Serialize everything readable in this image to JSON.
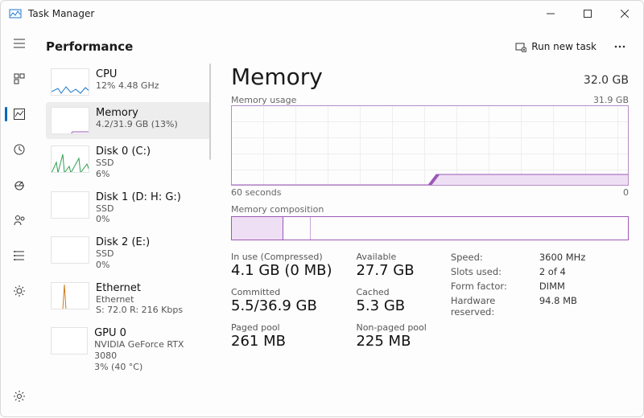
{
  "window": {
    "title": "Task Manager"
  },
  "header": {
    "page": "Performance",
    "run_new_task": "Run new task"
  },
  "sidebar": [
    {
      "title": "CPU",
      "sub1": "12% 4.48 GHz",
      "sub2": ""
    },
    {
      "title": "Memory",
      "sub1": "4.2/31.9 GB (13%)",
      "sub2": ""
    },
    {
      "title": "Disk 0 (C:)",
      "sub1": "SSD",
      "sub2": "6%"
    },
    {
      "title": "Disk 1 (D: H: G:)",
      "sub1": "SSD",
      "sub2": "0%"
    },
    {
      "title": "Disk 2 (E:)",
      "sub1": "SSD",
      "sub2": "0%"
    },
    {
      "title": "Ethernet",
      "sub1": "Ethernet",
      "sub2": "S: 72.0 R: 216 Kbps"
    },
    {
      "title": "GPU 0",
      "sub1": "NVIDIA GeForce RTX 3080",
      "sub2": "3% (40 °C)"
    }
  ],
  "detail": {
    "title": "Memory",
    "capacity": "32.0 GB",
    "usage_label": "Memory usage",
    "usage_max": "31.9 GB",
    "xaxis_left": "60 seconds",
    "xaxis_right": "0",
    "comp_label": "Memory composition",
    "groupA": {
      "inuse_lbl": "In use (Compressed)",
      "inuse_val": "4.1 GB (0 MB)",
      "committed_lbl": "Committed",
      "committed_val": "5.5/36.9 GB",
      "paged_lbl": "Paged pool",
      "paged_val": "261 MB"
    },
    "groupB": {
      "avail_lbl": "Available",
      "avail_val": "27.7 GB",
      "cached_lbl": "Cached",
      "cached_val": "5.3 GB",
      "nonpaged_lbl": "Non-paged pool",
      "nonpaged_val": "225 MB"
    },
    "kv": {
      "speed_k": "Speed:",
      "speed_v": "3600 MHz",
      "slots_k": "Slots used:",
      "slots_v": "2 of 4",
      "form_k": "Form factor:",
      "form_v": "DIMM",
      "hw_k": "Hardware reserved:",
      "hw_v": "94.8 MB"
    }
  },
  "chart_data": {
    "type": "line",
    "title": "Memory usage",
    "xlabel": "seconds",
    "ylabel": "GB",
    "x_range": [
      60,
      0
    ],
    "ylim": [
      0,
      31.9
    ],
    "series": [
      {
        "name": "In use",
        "x": [
          60,
          30,
          29,
          0
        ],
        "values": [
          0,
          0,
          4.2,
          4.2
        ]
      }
    ],
    "composition": {
      "in_use_pct": 13,
      "modified_pct": 7,
      "standby_free_pct": 80
    }
  }
}
